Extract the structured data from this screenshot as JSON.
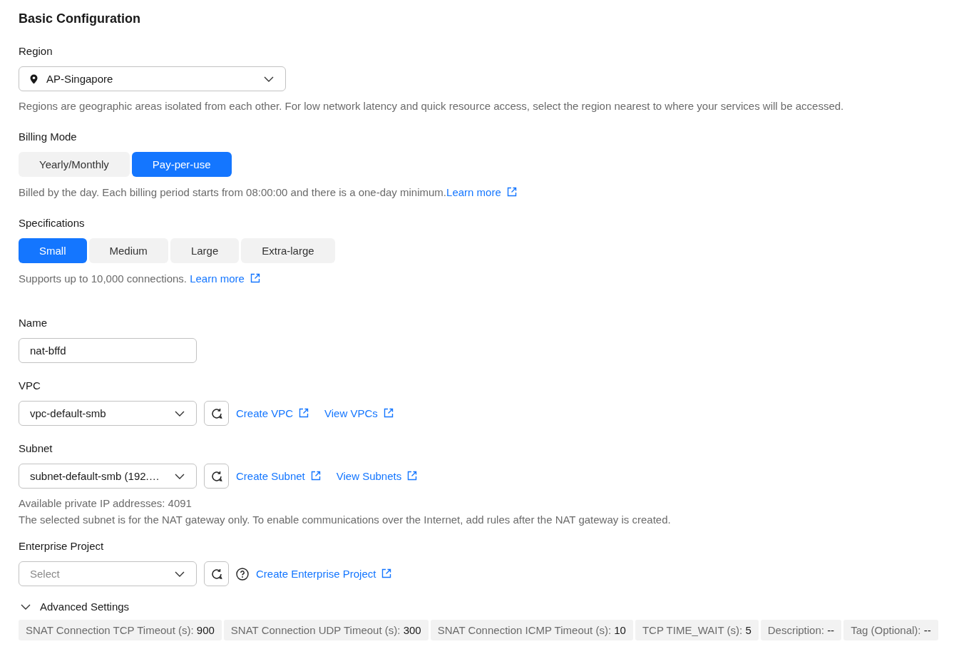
{
  "title": "Basic Configuration",
  "region": {
    "label": "Region",
    "value": "AP-Singapore",
    "hint": "Regions are geographic areas isolated from each other. For low network latency and quick resource access, select the region nearest to where your services will be accessed."
  },
  "billing_mode": {
    "label": "Billing Mode",
    "options": [
      {
        "label": "Yearly/Monthly",
        "selected": false
      },
      {
        "label": "Pay-per-use",
        "selected": true
      }
    ],
    "hint": "Billed by the day. Each billing period starts from 08:00:00 and there is a one-day minimum.",
    "link": "Learn more"
  },
  "specifications": {
    "label": "Specifications",
    "options": [
      {
        "label": "Small",
        "selected": true
      },
      {
        "label": "Medium",
        "selected": false
      },
      {
        "label": "Large",
        "selected": false
      },
      {
        "label": "Extra-large",
        "selected": false
      }
    ],
    "hint": "Supports up to 10,000 connections. ",
    "link": "Learn more"
  },
  "name": {
    "label": "Name",
    "value": "nat-bffd"
  },
  "vpc": {
    "label": "VPC",
    "value": "vpc-default-smb",
    "links": [
      "Create VPC",
      "View VPCs"
    ]
  },
  "subnet": {
    "label": "Subnet",
    "value": "subnet-default-smb (192.…",
    "links": [
      "Create Subnet",
      "View Subnets"
    ],
    "hints": [
      "Available private IP addresses: 4091",
      "The selected subnet is for the NAT gateway only. To enable communications over the Internet, add rules after the NAT gateway is created."
    ]
  },
  "enterprise_project": {
    "label": "Enterprise Project",
    "placeholder": "Select",
    "links": [
      "Create Enterprise Project"
    ]
  },
  "advanced_settings": {
    "label": "Advanced Settings",
    "expanded": false,
    "summary": [
      {
        "label": "SNAT Connection TCP Timeout (s): ",
        "value": "900"
      },
      {
        "label": "SNAT Connection UDP Timeout (s): ",
        "value": "300"
      },
      {
        "label": "SNAT Connection ICMP Timeout (s): ",
        "value": "10"
      },
      {
        "label": "TCP TIME_WAIT (s): ",
        "value": "5"
      },
      {
        "label": "Description: ",
        "value": "--"
      },
      {
        "label": "Tag (Optional): ",
        "value": "--"
      }
    ]
  }
}
